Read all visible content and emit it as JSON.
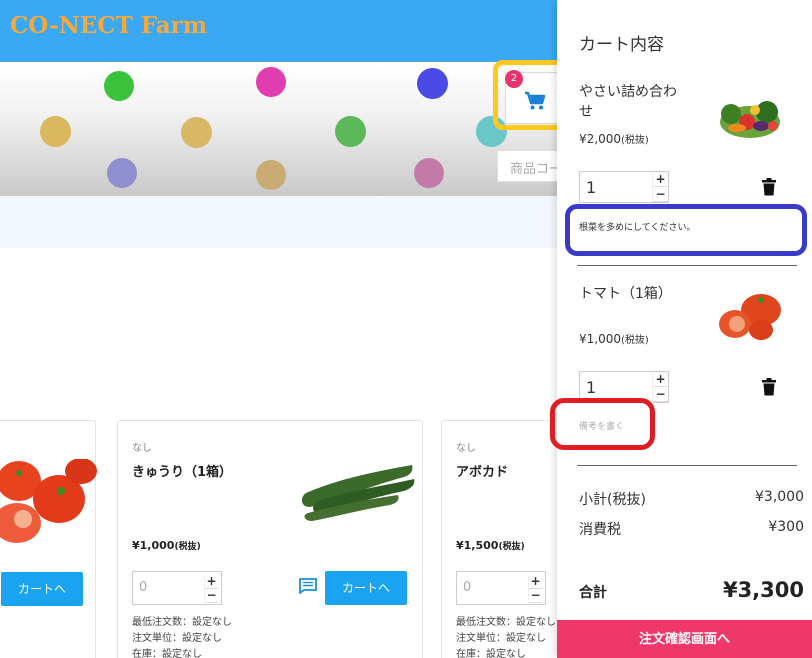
{
  "brand": {
    "logo_text": "CO-NECT Farm"
  },
  "header": {
    "cart_badge_count": "2",
    "search_placeholder": "商品コード"
  },
  "products": [
    {
      "tag": "",
      "name": "",
      "price": "",
      "cart_label": "カートへ"
    },
    {
      "tag": "なし",
      "name": "きゅうり（1箱）",
      "price": "¥1,000",
      "price_tax": "(税抜)",
      "qty_value": "0",
      "cart_label": "カートへ",
      "min_order": "最低注文数：設定なし",
      "order_unit": "注文単位：設定なし",
      "stock": "在庫：設定なし"
    },
    {
      "tag": "なし",
      "name": "アボカド",
      "price": "¥1,500",
      "price_tax": "(税抜)",
      "qty_value": "0",
      "min_order": "最低注文数：設定なし",
      "order_unit": "注文単位：設定なし",
      "stock": "在庫：設定なし"
    }
  ],
  "cart": {
    "title": "カート内容",
    "items": [
      {
        "name": "やさい詰め合わせ",
        "price": "¥2,000",
        "price_tax": "(税抜)",
        "qty": "1",
        "note": "根菜を多めにしてください。"
      },
      {
        "name": "トマト（1箱）",
        "price": "¥1,000",
        "price_tax": "(税抜)",
        "qty": "1",
        "note_placeholder": "備考を書く"
      }
    ],
    "subtotal_label": "小計(税抜)",
    "subtotal_value": "¥3,000",
    "tax_label": "消費税",
    "tax_value": "¥300",
    "total_label": "合計",
    "total_value": "¥3,300",
    "checkout_label": "注文確認画面へ"
  },
  "icons": {
    "cart": "cart-icon",
    "trash": "trash-icon",
    "comment": "comment-icon"
  },
  "colors": {
    "header_bg": "#3aa8f5",
    "logo": "#f7a83a",
    "accent_blue": "#1aa3f0",
    "checkout": "#f0376a",
    "badge": "#e8336d",
    "highlight_yellow": "#ffc81e",
    "highlight_blue": "#3a3ac7",
    "highlight_red": "#e01c24"
  }
}
